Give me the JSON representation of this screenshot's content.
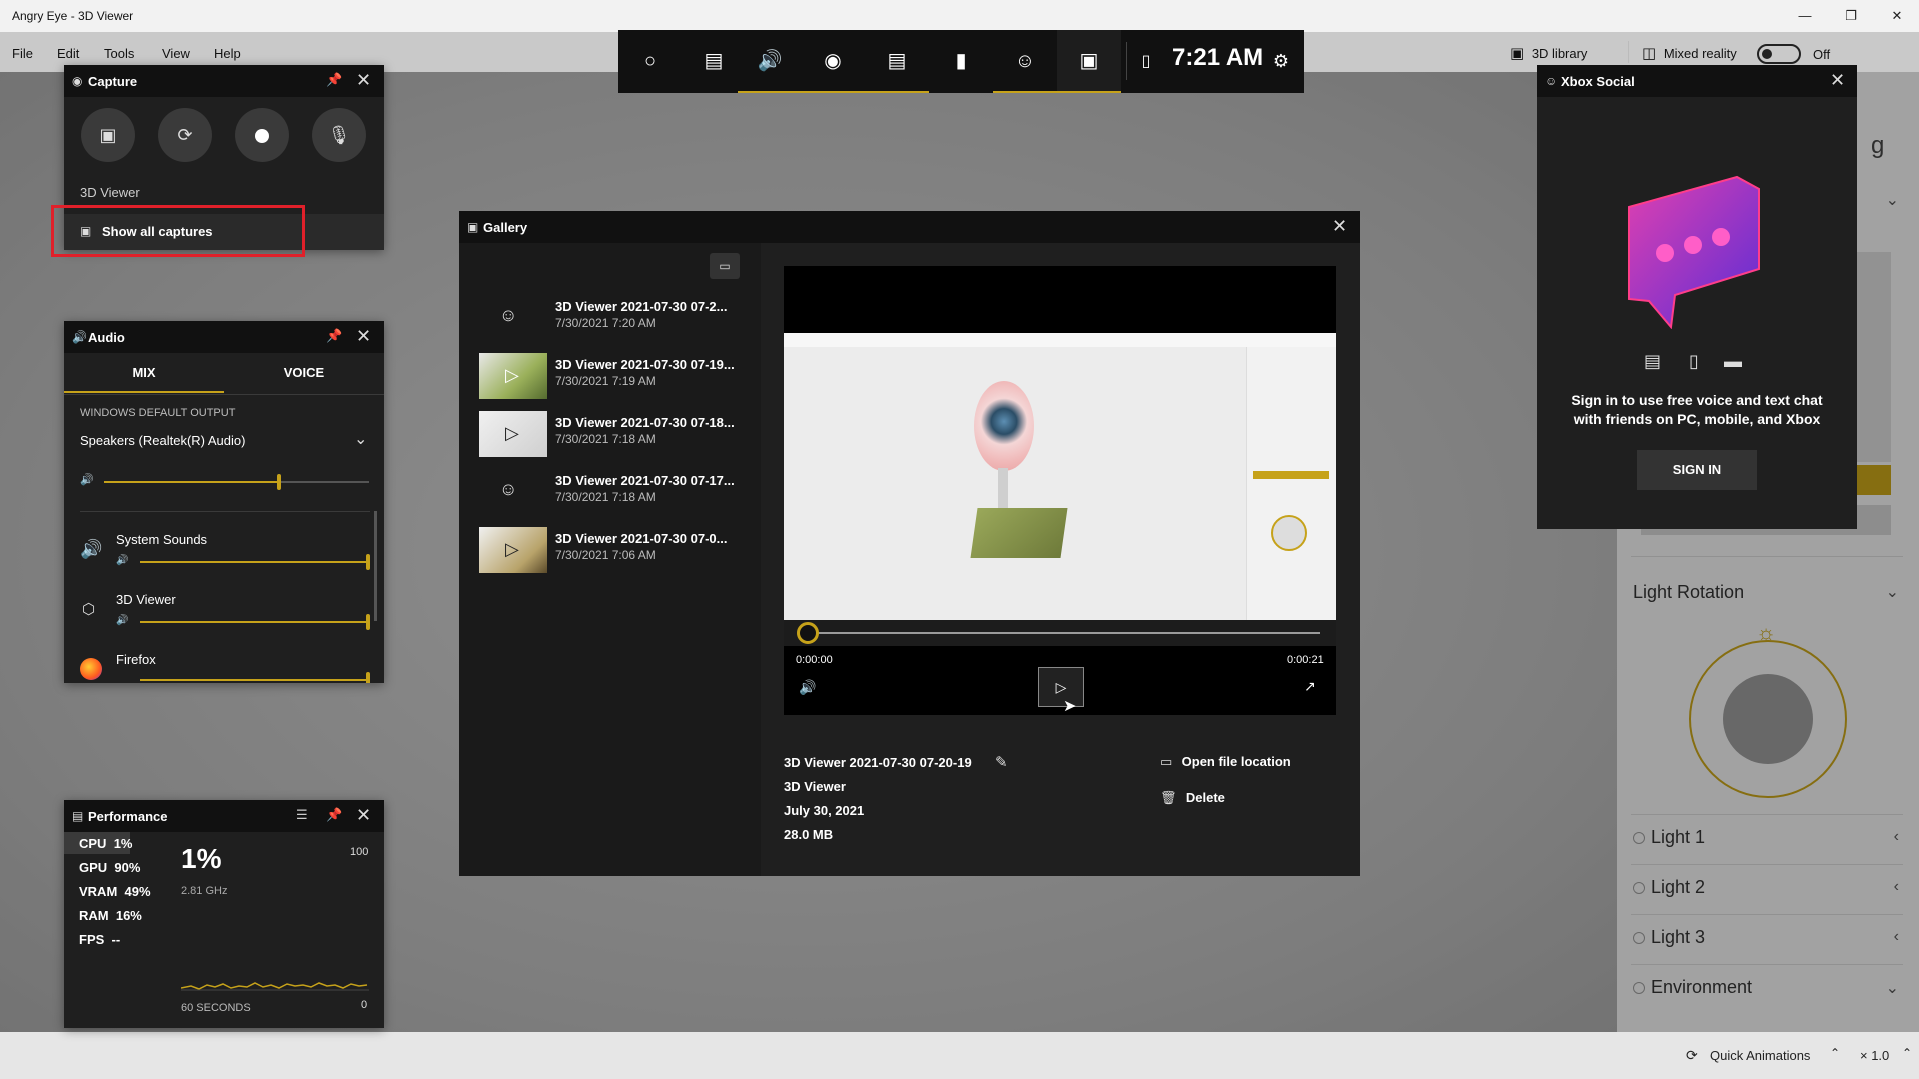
{
  "app": {
    "title": "Angry Eye - 3D Viewer",
    "menu": [
      "File",
      "Edit",
      "Tools",
      "View",
      "Help"
    ],
    "library_label": "3D library",
    "mixed_reality_label": "Mixed reality",
    "toggle_state": "Off",
    "right_panel": {
      "partial_heading": "g",
      "light_rotation": "Light Rotation",
      "lights": [
        "Light 1",
        "Light 2",
        "Light 3"
      ],
      "environment": "Environment"
    },
    "bottom": {
      "quick_animations": "Quick Animations",
      "speed": "× 1.0"
    }
  },
  "gamebar": {
    "time": "7:21 AM"
  },
  "capture": {
    "title": "Capture",
    "source": "3D Viewer",
    "show_all": "Show all captures"
  },
  "audio": {
    "title": "Audio",
    "tabs": [
      "MIX",
      "VOICE"
    ],
    "section": "WINDOWS DEFAULT OUTPUT",
    "device": "Speakers (Realtek(R) Audio)",
    "master_level": 0.66,
    "apps": [
      {
        "name": "System Sounds",
        "level": 1.0
      },
      {
        "name": "3D Viewer",
        "level": 1.0
      },
      {
        "name": "Firefox",
        "level": 1.0
      }
    ]
  },
  "gallery": {
    "title": "Gallery",
    "items": [
      {
        "title": "3D Viewer 2021-07-30 07-2...",
        "date": "7/30/2021 7:20 AM"
      },
      {
        "title": "3D Viewer 2021-07-30 07-19...",
        "date": "7/30/2021 7:19 AM"
      },
      {
        "title": "3D Viewer 2021-07-30 07-18...",
        "date": "7/30/2021 7:18 AM"
      },
      {
        "title": "3D Viewer 2021-07-30 07-17...",
        "date": "7/30/2021 7:18 AM"
      },
      {
        "title": "3D Viewer 2021-07-30 07-0...",
        "date": "7/30/2021 7:06 AM"
      }
    ],
    "player": {
      "time_current": "0:00:00",
      "time_total": "0:00:21"
    },
    "details": {
      "name": "3D Viewer 2021-07-30 07-20-19",
      "app": "3D Viewer",
      "date": "July 30, 2021",
      "size": "28.0 MB",
      "open_location": "Open file location",
      "delete": "Delete"
    }
  },
  "xbox_social": {
    "title": "Xbox Social",
    "message": "Sign in to use free voice and text chat with friends on PC, mobile, and Xbox",
    "sign_in": "SIGN IN"
  },
  "performance": {
    "title": "Performance",
    "stats": [
      {
        "label": "CPU",
        "value": "1%"
      },
      {
        "label": "GPU",
        "value": "90%"
      },
      {
        "label": "VRAM",
        "value": "49%"
      },
      {
        "label": "RAM",
        "value": "16%"
      },
      {
        "label": "FPS",
        "value": "--"
      }
    ],
    "big_value": "1%",
    "freq": "2.81 GHz",
    "max": "100",
    "min": "0",
    "window": "60 SECONDS"
  },
  "colors": {
    "accent": "#c6a21a",
    "highlight_box": "#e0202a",
    "panel": "#1f1f1f",
    "header": "#111111"
  }
}
